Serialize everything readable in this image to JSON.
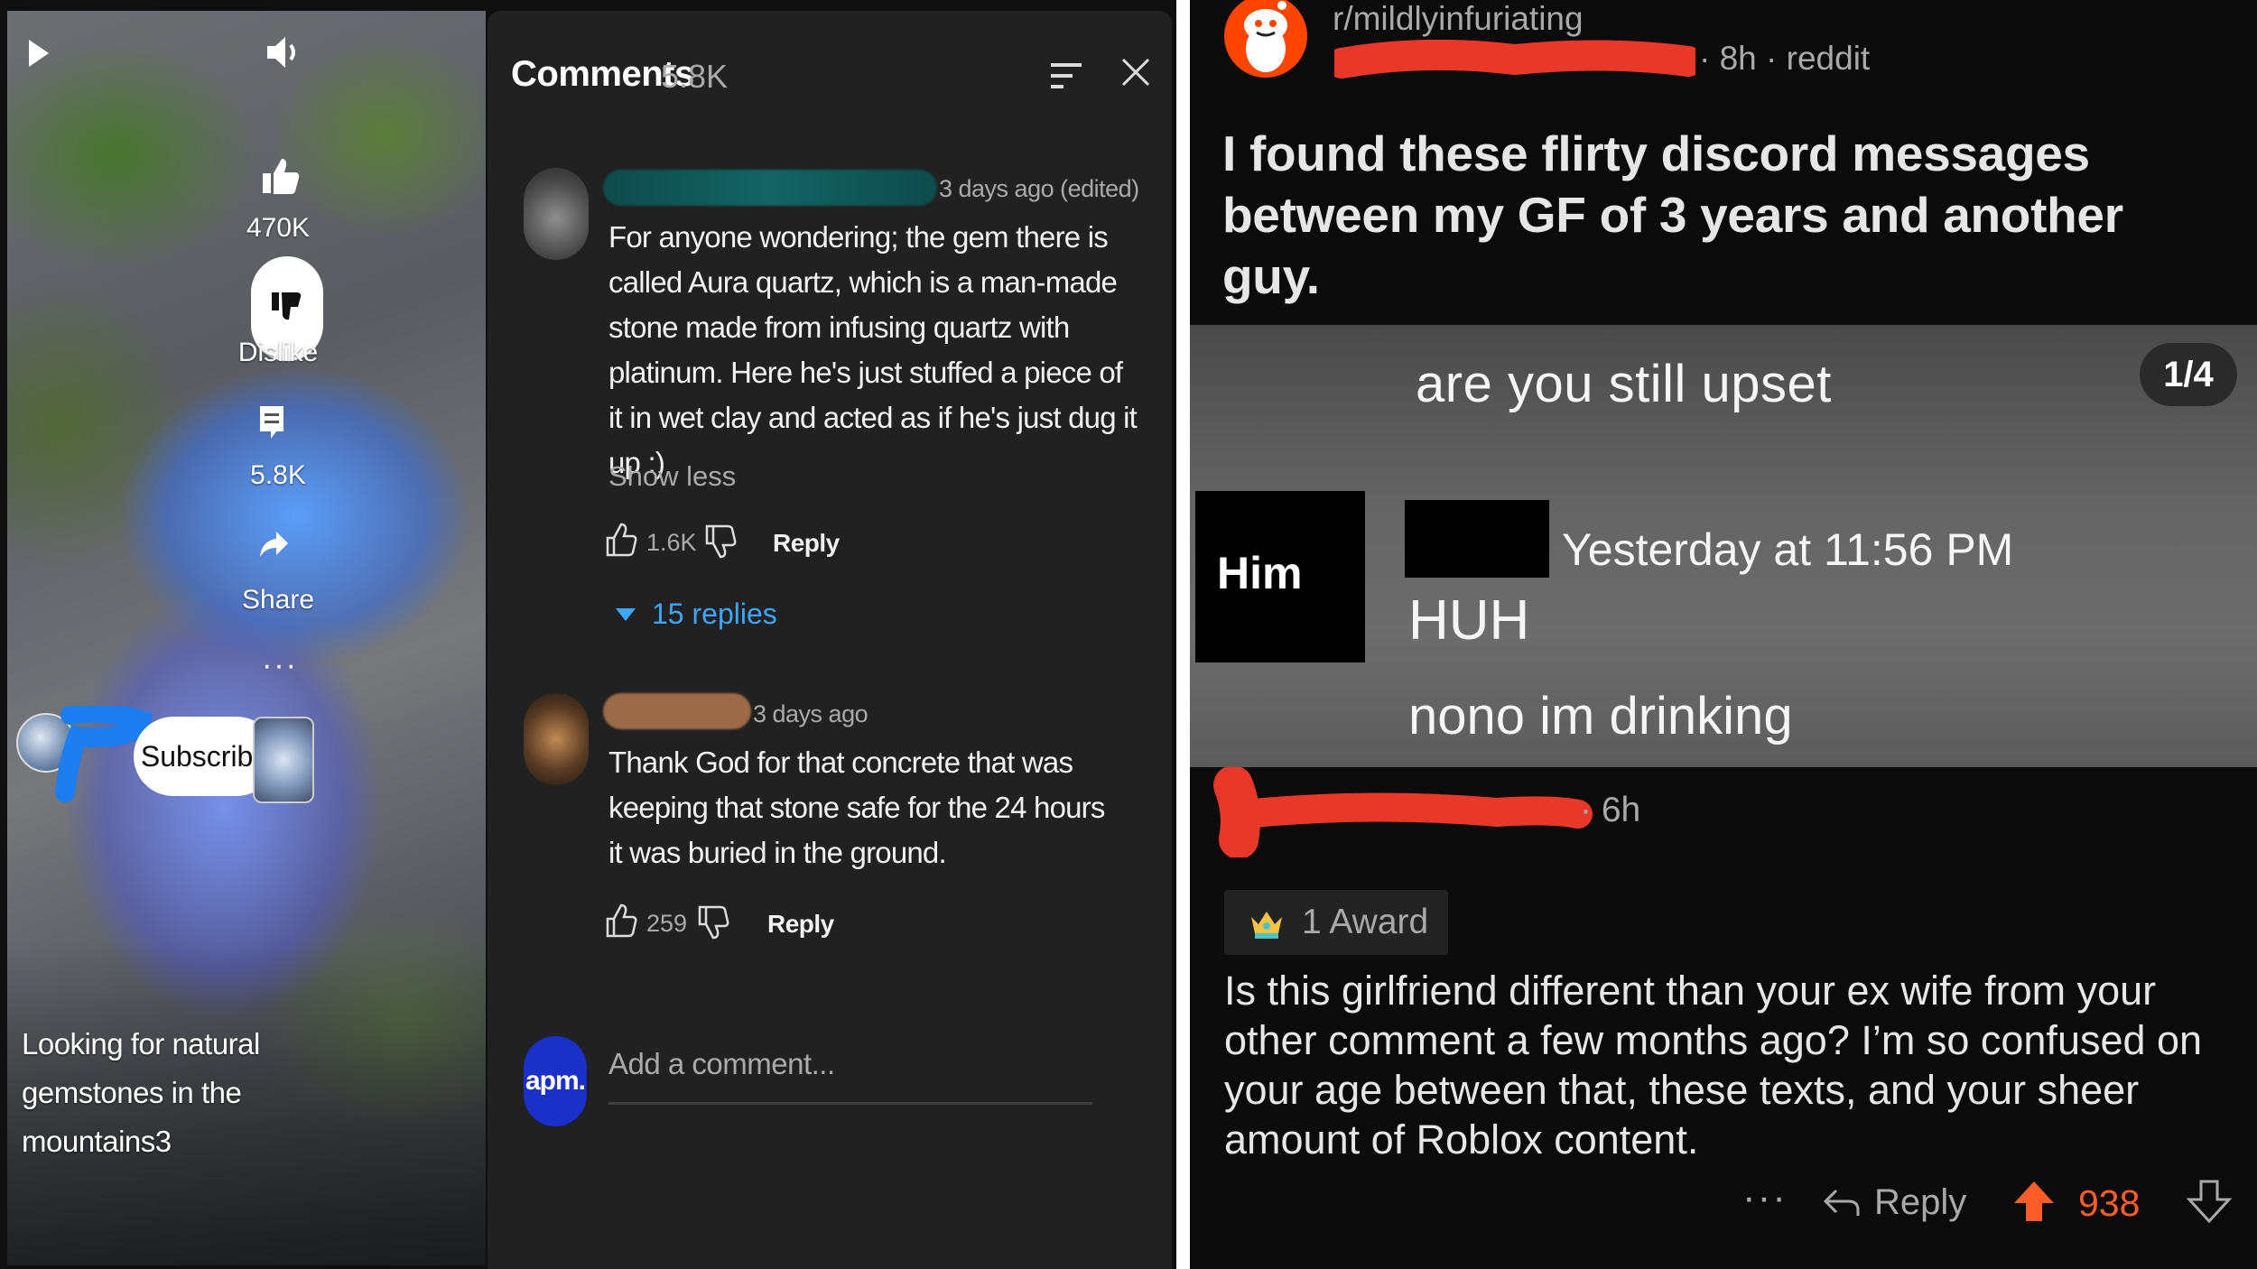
{
  "video": {
    "title": "Looking for natural gemstones in the mountains3",
    "like_count": "470K",
    "dislike_label": "Dislike",
    "comment_count": "5.8K",
    "share_label": "Share",
    "subscribe_label": "Subscribe"
  },
  "comments_panel": {
    "title": "Comments",
    "count": "5.8K",
    "add_comment_placeholder": "Add a comment...",
    "user_avatar_text": "apm.",
    "comments": [
      {
        "time": "3 days ago (edited)",
        "body": "For anyone wondering; the gem there is called Aura quartz, which is a man-made stone made from infusing quartz with platinum. Here he's just stuffed a piece of it in wet clay and acted as if he's just dug it up :)",
        "show_less": "Show less",
        "likes": "1.6K",
        "reply_label": "Reply",
        "replies_label": "15 replies"
      },
      {
        "time": "3 days ago",
        "body": "Thank God for that concrete that was keeping that stone safe for the 24 hours it was buried in the ground.",
        "likes": "259",
        "reply_label": "Reply"
      }
    ]
  },
  "reddit": {
    "subreddit": "r/mildlyinfuriating",
    "post_meta": "· 8h · reddit",
    "post_title": "I found these flirty discord messages between my GF of 3 years and another guy.",
    "screenshot": {
      "top_text": "are you still upset",
      "badge": "1/4",
      "sender_label": "Him",
      "timestamp": "Yesterday at 11:56 PM",
      "line1": "HUH",
      "line2": "nono im drinking"
    },
    "comment": {
      "time": "· 6h",
      "award_label": "1 Award",
      "body": "Is this girlfriend different than your ex wife from your other comment a few months ago? I’m so confused on your age between that, these texts, and your sheer amount of Roblox content.",
      "more": "···",
      "reply_label": "Reply",
      "score": "938"
    },
    "colors": {
      "upvote": "#ff5c27",
      "redaction": "#e8382a"
    }
  }
}
